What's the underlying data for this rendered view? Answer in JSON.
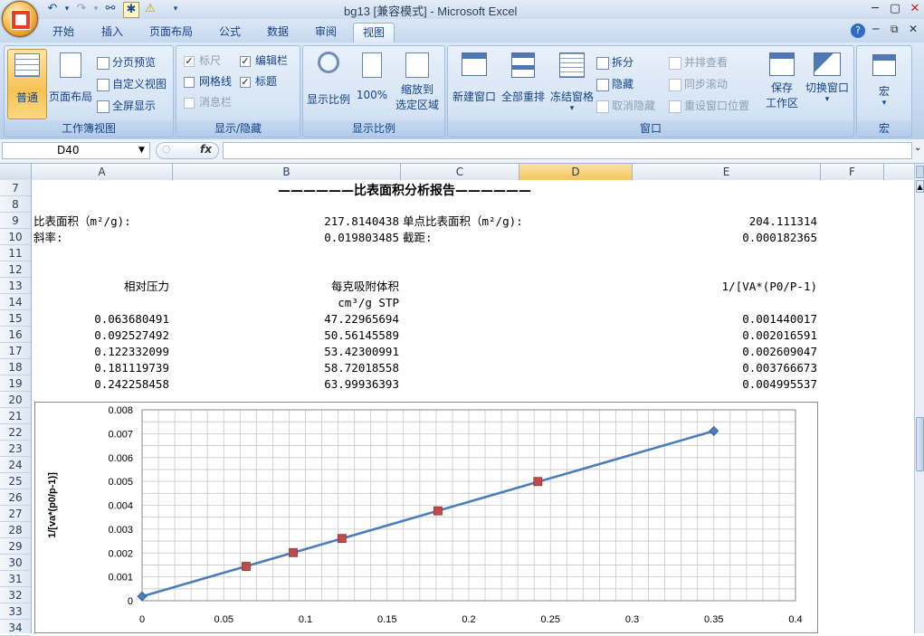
{
  "window": {
    "title": "bg13  [兼容模式] - Microsoft Excel",
    "controls": [
      "─",
      "▢",
      "✕"
    ]
  },
  "tabs": [
    {
      "label": "开始"
    },
    {
      "label": "插入"
    },
    {
      "label": "页面布局"
    },
    {
      "label": "公式"
    },
    {
      "label": "数据"
    },
    {
      "label": "审阅"
    },
    {
      "label": "视图",
      "active": true
    }
  ],
  "ribbon": {
    "workbook_views": {
      "group_label": "工作簿视图",
      "normal": "普通",
      "page_layout": "页面布局",
      "page_break_preview": "分页预览",
      "custom_views": "自定义视图",
      "full_screen": "全屏显示"
    },
    "show_hide": {
      "group_label": "显示/隐藏",
      "ruler": "标尺",
      "gridlines": "网格线",
      "message_bar": "消息栏",
      "formula_bar": "编辑栏",
      "headings": "标题"
    },
    "zoom": {
      "group_label": "显示比例",
      "zoom": "显示比例",
      "zoom_100": "100%",
      "zoom_to_selection_line1": "缩放到",
      "zoom_to_selection_line2": "选定区域"
    },
    "window": {
      "group_label": "窗口",
      "new_window": "新建窗口",
      "arrange_all": "全部重排",
      "freeze_panes": "冻结窗格",
      "split": "拆分",
      "hide": "隐藏",
      "unhide": "取消隐藏",
      "view_side_by_side": "并排查看",
      "synchronous_scrolling": "同步滚动",
      "reset_window_position": "重设窗口位置",
      "save_workspace_line1": "保存",
      "save_workspace_line2": "工作区",
      "switch_windows": "切换窗口"
    },
    "macros": {
      "group_label": "宏",
      "macros": "宏"
    }
  },
  "formula_bar": {
    "name_box": "D40",
    "fx": "fx",
    "value": ""
  },
  "columns": [
    "A",
    "B",
    "C",
    "D",
    "E",
    "F"
  ],
  "selected_column": "D",
  "rows": [
    "7",
    "8",
    "9",
    "10",
    "11",
    "12",
    "13",
    "14",
    "15",
    "16",
    "17",
    "18",
    "19",
    "20",
    "21",
    "22",
    "23",
    "24",
    "25",
    "26",
    "27",
    "28",
    "29",
    "30",
    "31",
    "32",
    "33",
    "34"
  ],
  "sheet": {
    "report_title": "——————比表面积分析报告——————",
    "bet_label": "比表面积（m²/g):",
    "bet_value": "217.8140438",
    "single_point_label": "单点比表面积（m²/g):",
    "single_point_value": "204.111314",
    "slope_label": "斜率:",
    "slope_value": "0.019803485",
    "intercept_label": "截距:",
    "intercept_value": "0.000182365",
    "header_pressure": "相对压力",
    "header_volume": "每克吸附体积",
    "header_volume_unit": "cm³/g STP",
    "header_bet": "1/[VA*(P0/P-1)",
    "table": [
      [
        "0.063680491",
        "47.22965694",
        "0.001440017"
      ],
      [
        "0.092527492",
        "50.56145589",
        "0.002016591"
      ],
      [
        "0.122332099",
        "53.42300991",
        "0.002609047"
      ],
      [
        "0.181119739",
        "58.72018558",
        "0.003766673"
      ],
      [
        "0.242258458",
        "63.99936393",
        "0.004995537"
      ]
    ]
  },
  "chart_data": {
    "type": "scatter",
    "title": "",
    "xlabel": "",
    "ylabel": "1/[va*(p0/p-1)]",
    "xlim": [
      0,
      0.4
    ],
    "ylim": [
      0,
      0.008
    ],
    "x_ticks": [
      "0",
      "0.05",
      "0.1",
      "0.15",
      "0.2",
      "0.25",
      "0.3",
      "0.35",
      "0.4"
    ],
    "y_ticks": [
      "0",
      "0.001",
      "0.002",
      "0.003",
      "0.004",
      "0.005",
      "0.006",
      "0.007",
      "0.008"
    ],
    "grid": true,
    "series": [
      {
        "marker": "square",
        "color": "#be4b48",
        "x": [
          0.063680491,
          0.092527492,
          0.122332099,
          0.181119739,
          0.242258458
        ],
        "y": [
          0.001440017,
          0.002016591,
          0.002609047,
          0.003766673,
          0.004995537
        ]
      },
      {
        "marker": "diamond",
        "color": "#4a7ebb",
        "line": true,
        "x": [
          0,
          0.35
        ],
        "y": [
          0.000182365,
          0.007113585
        ]
      }
    ]
  }
}
